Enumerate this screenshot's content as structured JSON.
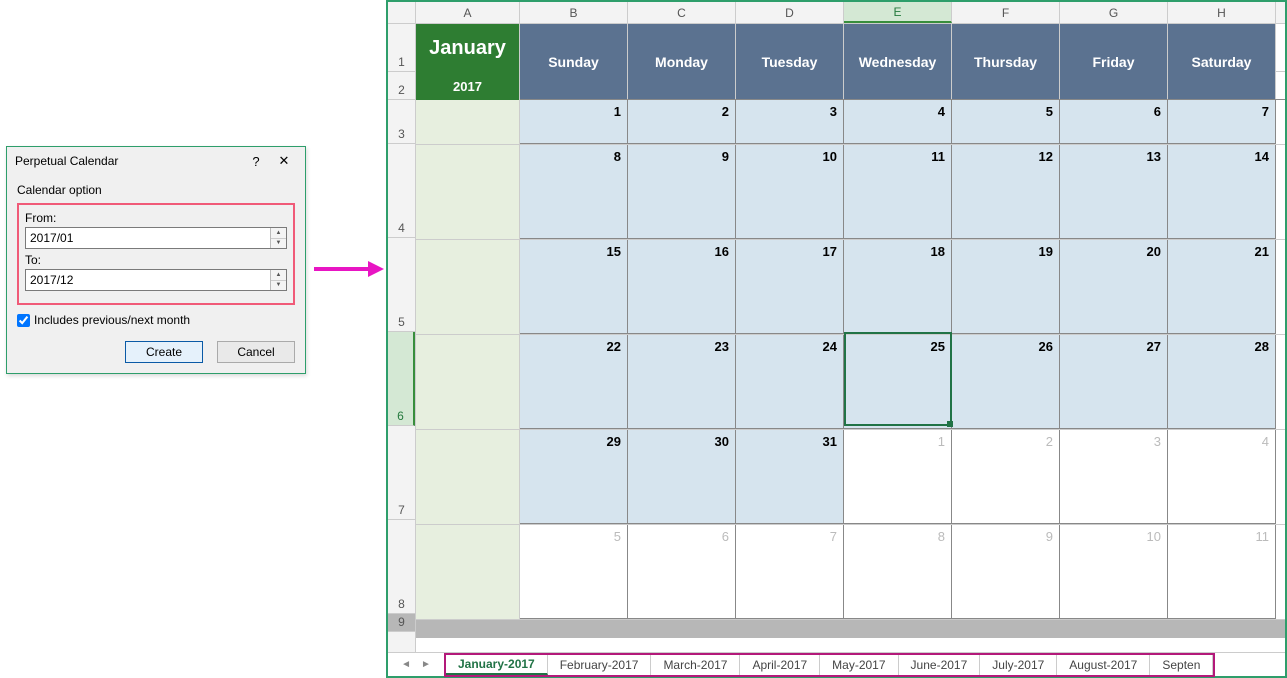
{
  "dialog": {
    "title": "Perpetual Calendar",
    "option_label": "Calendar option",
    "from_label": "From:",
    "from_value": "2017/01",
    "to_label": "To:",
    "to_value": "2017/12",
    "include_label": "Includes previous/next month",
    "create": "Create",
    "cancel": "Cancel"
  },
  "columns": [
    "A",
    "B",
    "C",
    "D",
    "E",
    "F",
    "G",
    "H"
  ],
  "rows": [
    "1",
    "2",
    "3",
    "4",
    "5",
    "6",
    "7",
    "8",
    "9"
  ],
  "month": "January",
  "year": "2017",
  "dow": [
    "Sunday",
    "Monday",
    "Tuesday",
    "Wednesday",
    "Thursday",
    "Friday",
    "Saturday"
  ],
  "weeks": [
    [
      {
        "n": "1"
      },
      {
        "n": "2"
      },
      {
        "n": "3"
      },
      {
        "n": "4"
      },
      {
        "n": "5"
      },
      {
        "n": "6"
      },
      {
        "n": "7"
      }
    ],
    [
      {
        "n": "8"
      },
      {
        "n": "9"
      },
      {
        "n": "10"
      },
      {
        "n": "11"
      },
      {
        "n": "12"
      },
      {
        "n": "13"
      },
      {
        "n": "14"
      }
    ],
    [
      {
        "n": "15"
      },
      {
        "n": "16"
      },
      {
        "n": "17"
      },
      {
        "n": "18"
      },
      {
        "n": "19"
      },
      {
        "n": "20"
      },
      {
        "n": "21"
      }
    ],
    [
      {
        "n": "22"
      },
      {
        "n": "23"
      },
      {
        "n": "24"
      },
      {
        "n": "25"
      },
      {
        "n": "26"
      },
      {
        "n": "27"
      },
      {
        "n": "28"
      }
    ],
    [
      {
        "n": "29"
      },
      {
        "n": "30"
      },
      {
        "n": "31"
      },
      {
        "n": "1",
        "m": true
      },
      {
        "n": "2",
        "m": true
      },
      {
        "n": "3",
        "m": true
      },
      {
        "n": "4",
        "m": true
      }
    ],
    [
      {
        "n": "5",
        "m": true
      },
      {
        "n": "6",
        "m": true
      },
      {
        "n": "7",
        "m": true
      },
      {
        "n": "8",
        "m": true
      },
      {
        "n": "9",
        "m": true
      },
      {
        "n": "10",
        "m": true
      },
      {
        "n": "11",
        "m": true
      }
    ]
  ],
  "tabs": [
    "January-2017",
    "February-2017",
    "March-2017",
    "April-2017",
    "May-2017",
    "June-2017",
    "July-2017",
    "August-2017",
    "Septen"
  ],
  "active_tab": 0
}
